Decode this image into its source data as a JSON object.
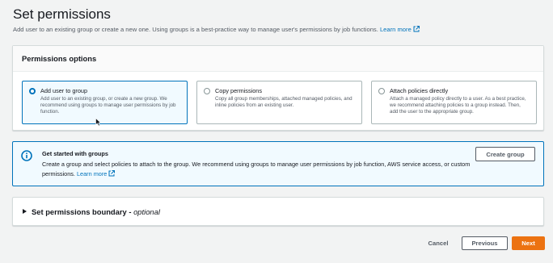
{
  "page": {
    "title": "Set permissions",
    "description": "Add user to an existing group or create a new one. Using groups is a best-practice way to manage user's permissions by job functions.",
    "learn_more": "Learn more"
  },
  "permissions_panel": {
    "title": "Permissions options",
    "options": [
      {
        "label": "Add user to group",
        "description": "Add user to an existing group, or create a new group. We recommend using groups to manage user permissions by job function.",
        "selected": true
      },
      {
        "label": "Copy permissions",
        "description": "Copy all group memberships, attached managed policies, and inline policies from an existing user.",
        "selected": false
      },
      {
        "label": "Attach policies directly",
        "description": "Attach a managed policy directly to a user. As a best practice, we recommend attaching policies to a group instead. Then, add the user to the appropriate group.",
        "selected": false
      }
    ]
  },
  "info_box": {
    "title": "Get started with groups",
    "text": "Create a group and select policies to attach to the group. We recommend using groups to manage user permissions by job function, AWS service access, or custom permissions.",
    "learn_more": "Learn more",
    "button_label": "Create group"
  },
  "boundary": {
    "title": "Set permissions boundary -",
    "optional": "optional"
  },
  "footer": {
    "cancel": "Cancel",
    "previous": "Previous",
    "next": "Next"
  },
  "colors": {
    "accent": "#0073bb",
    "primary_button": "#ec7211",
    "background": "#f2f3f3"
  },
  "icons": [
    "external-link-icon",
    "info-icon",
    "caret-right-icon",
    "radio-icon",
    "mouse-cursor-icon"
  ]
}
